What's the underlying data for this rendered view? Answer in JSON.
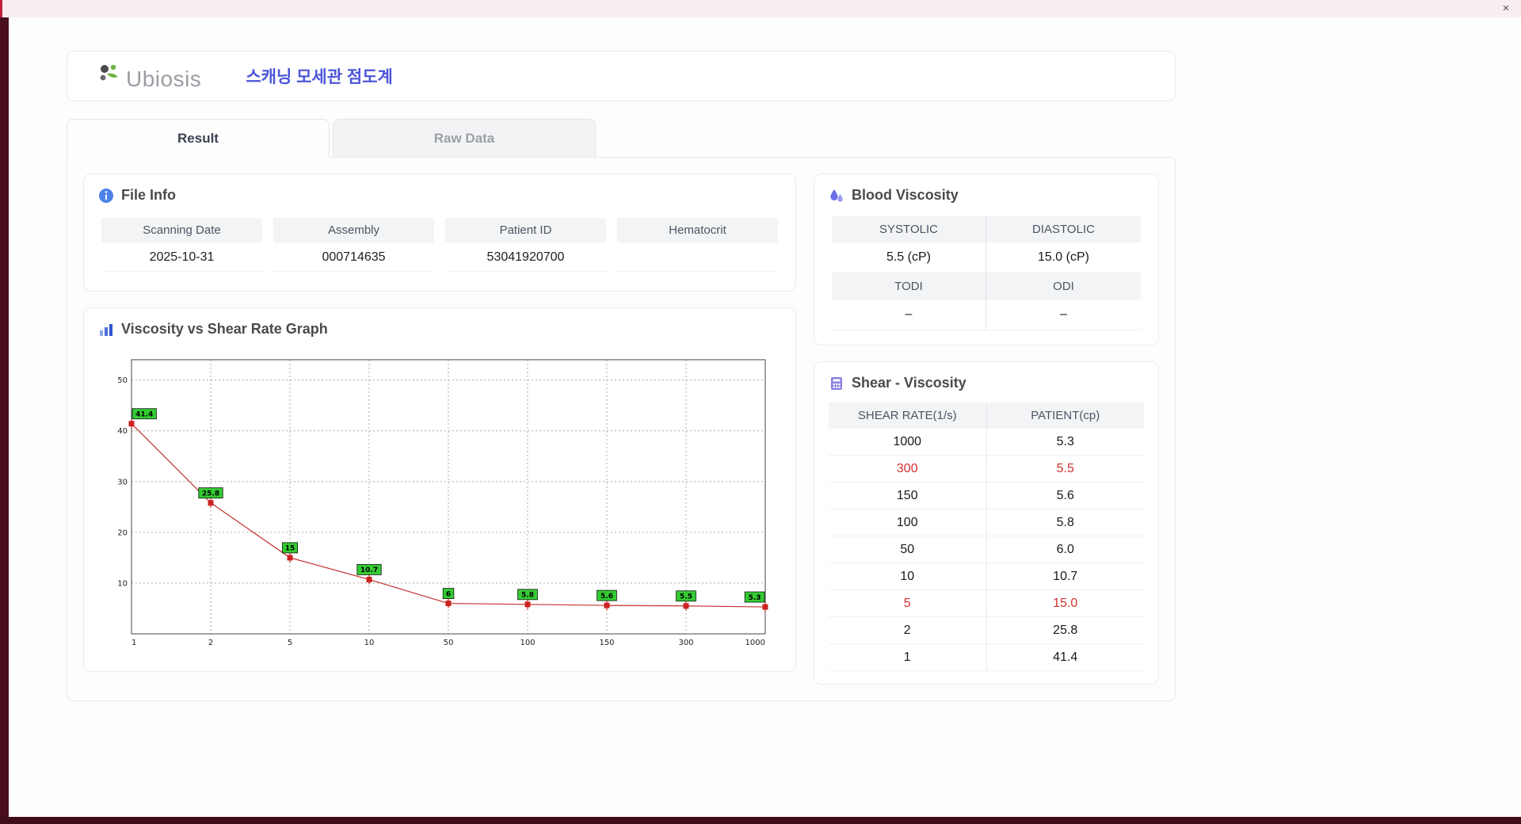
{
  "window": {
    "close": "×"
  },
  "header": {
    "brand": "Ubiosis",
    "title": "스캐닝 모세관 점도계"
  },
  "tabs": [
    {
      "label": "Result",
      "active": true
    },
    {
      "label": "Raw Data",
      "active": false
    }
  ],
  "file_info": {
    "title": "File Info",
    "fields": [
      {
        "label": "Scanning Date",
        "value": "2025-10-31"
      },
      {
        "label": "Assembly",
        "value": "000714635"
      },
      {
        "label": "Patient ID",
        "value": "53041920700"
      },
      {
        "label": "Hematocrit",
        "value": ""
      }
    ]
  },
  "blood_viscosity": {
    "title": "Blood Viscosity",
    "pairs": [
      {
        "labels": [
          "SYSTOLIC",
          "DIASTOLIC"
        ],
        "values": [
          "5.5 (cP)",
          "15.0 (cP)"
        ]
      },
      {
        "labels": [
          "TODI",
          "ODI"
        ],
        "values": [
          "–",
          "–"
        ]
      }
    ]
  },
  "graph": {
    "title": "Viscosity vs Shear Rate Graph"
  },
  "chart_data": {
    "type": "line",
    "title": "Viscosity vs Shear Rate Graph",
    "x": [
      1,
      2,
      5,
      10,
      50,
      100,
      150,
      300,
      1000
    ],
    "xtick_labels": [
      "1",
      "2",
      "5",
      "10",
      "50",
      "100",
      "150",
      "300",
      "1000"
    ],
    "values": [
      41.4,
      25.8,
      15,
      10.7,
      6,
      5.8,
      5.6,
      5.5,
      5.3
    ],
    "point_labels": [
      "41.4",
      "25.8",
      "15",
      "10.7",
      "6",
      "5.8",
      "5.6",
      "5.5",
      "5.3"
    ],
    "yticks": [
      10,
      20,
      30,
      40,
      50
    ],
    "ylim": [
      0,
      54
    ],
    "x_scale": "categorical-log-ticks",
    "grid": true,
    "legend": "none",
    "line_color": "#c62f2f",
    "marker_color": "#cc2222",
    "label_bg": "#33cc33",
    "label_border": "#111111"
  },
  "shear_table": {
    "title": "Shear - Viscosity",
    "columns": [
      "SHEAR RATE(1/s)",
      "PATIENT(cp)"
    ],
    "rows": [
      {
        "shear": "1000",
        "patient": "5.3",
        "highlight": false
      },
      {
        "shear": "300",
        "patient": "5.5",
        "highlight": true
      },
      {
        "shear": "150",
        "patient": "5.6",
        "highlight": false
      },
      {
        "shear": "100",
        "patient": "5.8",
        "highlight": false
      },
      {
        "shear": "50",
        "patient": "6.0",
        "highlight": false
      },
      {
        "shear": "10",
        "patient": "10.7",
        "highlight": false
      },
      {
        "shear": "5",
        "patient": "15.0",
        "highlight": true
      },
      {
        "shear": "2",
        "patient": "25.8",
        "highlight": false
      },
      {
        "shear": "1",
        "patient": "41.4",
        "highlight": false
      }
    ]
  }
}
